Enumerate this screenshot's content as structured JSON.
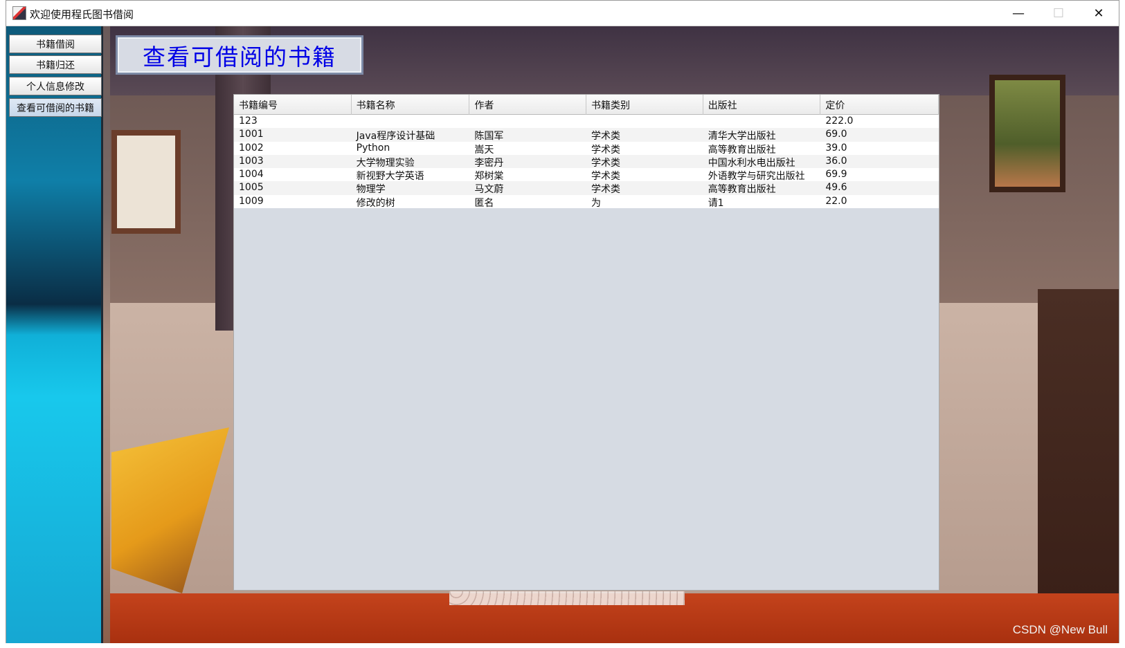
{
  "window": {
    "title": "欢迎使用程氏图书借阅",
    "controls": {
      "minimize": "—",
      "maximize": "☐",
      "close": "✕"
    }
  },
  "sidebar": {
    "items": [
      {
        "label": "书籍借阅"
      },
      {
        "label": "书籍归还"
      },
      {
        "label": "个人信息修改"
      },
      {
        "label": "查看可借阅的书籍"
      }
    ]
  },
  "main": {
    "heading": "查看可借阅的书籍",
    "table": {
      "columns": [
        "书籍编号",
        "书籍名称",
        "作者",
        "书籍类别",
        "出版社",
        "定价"
      ],
      "rows": [
        [
          "123",
          "",
          "",
          "",
          "",
          "222.0"
        ],
        [
          "1001",
          "Java程序设计基础",
          "陈国军",
          "学术类",
          "清华大学出版社",
          "69.0"
        ],
        [
          "1002",
          "Python",
          "嵩天",
          "学术类",
          "高等教育出版社",
          "39.0"
        ],
        [
          "1003",
          "大学物理实验",
          "李密丹",
          "学术类",
          "中国水利水电出版社",
          "36.0"
        ],
        [
          "1004",
          "新视野大学英语",
          "郑树棠",
          "学术类",
          "外语教学与研究出版社",
          "69.9"
        ],
        [
          "1005",
          "物理学",
          "马文蔚",
          "学术类",
          "高等教育出版社",
          "49.6"
        ],
        [
          "1009",
          "修改的树",
          "匿名",
          "为",
          "请1",
          "22.0"
        ]
      ]
    }
  },
  "watermark": "CSDN @New Bull",
  "colors": {
    "heading_text": "#0000e6",
    "sidebar_bg": "#16a7d2"
  }
}
